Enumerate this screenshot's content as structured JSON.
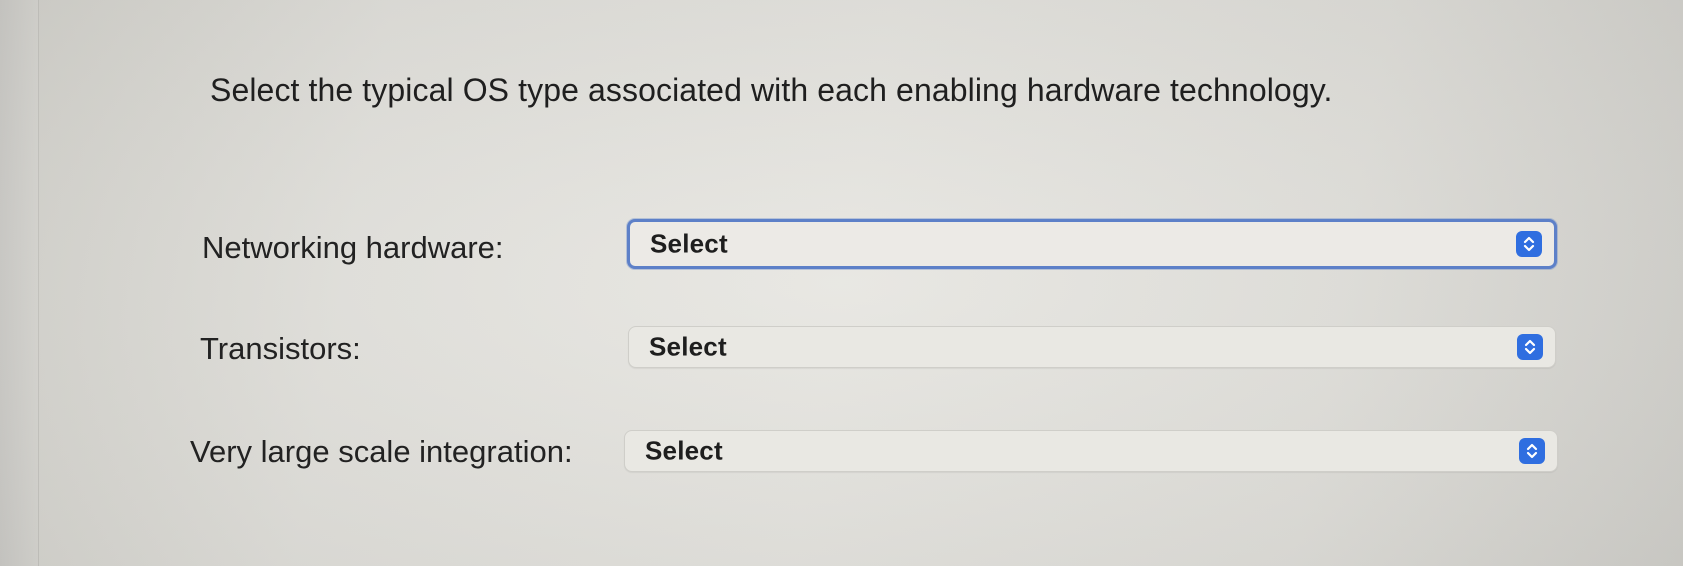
{
  "question": {
    "text": "Select the typical OS type associated with each enabling hardware technology."
  },
  "rows": [
    {
      "label": "Networking hardware:",
      "selected": "Select",
      "focused": true
    },
    {
      "label": "Transistors:",
      "selected": "Select",
      "focused": false
    },
    {
      "label": "Very large scale integration:",
      "selected": "Select",
      "focused": false
    }
  ],
  "colors": {
    "accent": "#2f6ee0",
    "focus_ring": "#5d80c8",
    "background": "#e3e2dd"
  },
  "icons": {
    "dropdown": "chevron-updown-icon"
  }
}
